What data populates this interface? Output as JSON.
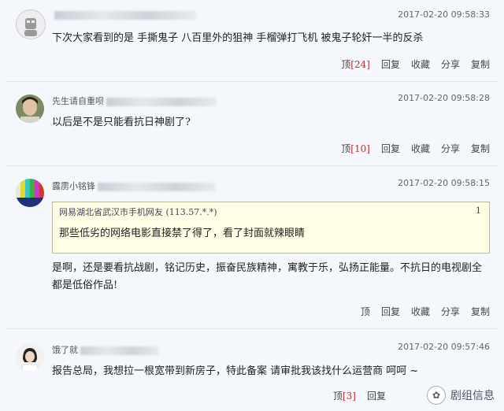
{
  "comments": [
    {
      "username": "",
      "timestamp": "2017-02-20 09:58:33",
      "text": "下次大家看到的是 手撕鬼子 八百里外的狙神 手榴弹打飞机 被鬼子轮奸一半的反杀",
      "actions": {
        "up_label": "顶",
        "up_count": "[24]",
        "reply": "回复",
        "favorite": "收藏",
        "share": "分享",
        "copy": "复制"
      }
    },
    {
      "username": "先生请自重呗",
      "timestamp": "2017-02-20 09:58:28",
      "text": "以后是不是只能看抗日神剧了?",
      "actions": {
        "up_label": "顶",
        "up_count": "[10]",
        "reply": "回复",
        "favorite": "收藏",
        "share": "分享",
        "copy": "复制"
      }
    },
    {
      "username": "露雳小铭锋",
      "timestamp": "2017-02-20 09:58:15",
      "quote": {
        "source": "网易湖北省武汉市手机网友 (113.57.*.*)",
        "floor": "1",
        "text": "那些低劣的网络电影直接禁了得了，看了封面就辣眼睛"
      },
      "text_line1": "是啊，还是要看抗战剧，铭记历史，振奋民族精神，寓教于乐，弘扬正能量。不抗日的电视剧全",
      "text_line2": "都是低俗作品!",
      "actions": {
        "up_label": "顶",
        "up_count": "",
        "reply": "回复",
        "favorite": "收藏",
        "share": "分享",
        "copy": "复制"
      }
    },
    {
      "username": "饿了就",
      "timestamp": "2017-02-20 09:57:46",
      "text": "报告总局，我想拉一根宽带到新房子，特此备案 请审批我该找什么运营商 呵呵 ~",
      "actions": {
        "up_label": "顶",
        "up_count": "[3]",
        "reply": "回复",
        "favorite": "收藏",
        "share": "分享",
        "copy": "复制"
      }
    }
  ],
  "watermark": {
    "text": "剧组信息"
  }
}
